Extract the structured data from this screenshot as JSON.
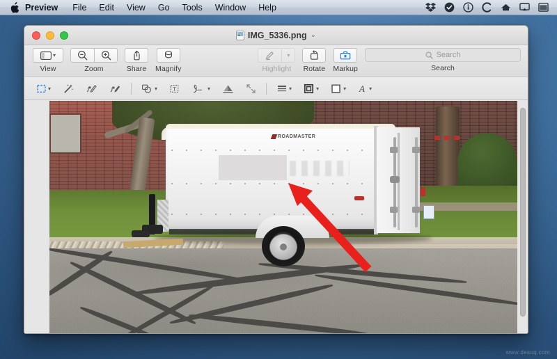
{
  "menubar": {
    "apple_icon": "apple-logo-icon",
    "items": [
      {
        "label": "Preview",
        "bold": true
      },
      {
        "label": "File",
        "bold": false
      },
      {
        "label": "Edit",
        "bold": false
      },
      {
        "label": "View",
        "bold": false
      },
      {
        "label": "Go",
        "bold": false
      },
      {
        "label": "Tools",
        "bold": false
      },
      {
        "label": "Window",
        "bold": false
      },
      {
        "label": "Help",
        "bold": false
      }
    ],
    "status_icons": [
      "dropbox-icon",
      "checkmark-circle-icon",
      "info-circle-icon",
      "chrome-c-icon",
      "home-icon",
      "airplay-icon",
      "calendar-icon"
    ]
  },
  "window": {
    "title": "IMG_5336.png",
    "title_chevron": "⌄",
    "doc_icon": "image-document-icon",
    "traffic_lights": [
      "close-button",
      "minimize-button",
      "zoom-button"
    ]
  },
  "toolbar": {
    "view_label": "View",
    "zoom_label": "Zoom",
    "share_label": "Share",
    "magnify_label": "Magnify",
    "highlight_label": "Highlight",
    "rotate_label": "Rotate",
    "markup_label": "Markup",
    "search_group_label": "Search",
    "search_placeholder": "Search",
    "zoom_out_icon": "zoom-out-icon",
    "zoom_in_icon": "zoom-in-icon",
    "share_icon": "share-icon",
    "magnify_icon": "loupe-icon",
    "highlight_icon": "highlighter-pen-icon",
    "rotate_icon": "rotate-left-icon",
    "markup_icon": "markup-toolbox-icon",
    "search_icon": "search-icon",
    "highlight_disabled": true,
    "markup_active": true
  },
  "markup_bar": {
    "tools": [
      {
        "name": "rectangular-selection-tool",
        "active": true,
        "has_chevron": true
      },
      {
        "name": "instant-alpha-tool",
        "active": false,
        "has_chevron": false
      },
      {
        "name": "sketch-tool",
        "active": false,
        "has_chevron": false
      },
      {
        "name": "draw-tool",
        "active": false,
        "has_chevron": false
      },
      {
        "name": "shapes-tool",
        "active": false,
        "has_chevron": true
      },
      {
        "name": "text-tool",
        "active": false,
        "has_chevron": false
      },
      {
        "name": "signature-tool",
        "active": false,
        "has_chevron": true
      },
      {
        "name": "adjust-color-tool",
        "active": false,
        "has_chevron": false
      },
      {
        "name": "adjust-size-tool",
        "active": false,
        "has_chevron": false
      },
      {
        "name": "shape-style-tool",
        "active": false,
        "has_chevron": true
      },
      {
        "name": "border-color-tool",
        "active": false,
        "has_chevron": true
      },
      {
        "name": "fill-color-tool",
        "active": false,
        "has_chevron": true
      },
      {
        "name": "text-style-tool",
        "active": false,
        "has_chevron": true
      }
    ]
  },
  "photo": {
    "description": "white enclosed cargo trailer parked in a lot in front of a red brick building",
    "trailer_brand": "ROADMASTER",
    "redaction_block": "white-rectangle-redaction",
    "arrow_annotation": "red-arrow-annotation",
    "arrow_color": "#e8211c"
  },
  "colors": {
    "accent_blue": "#3b7fd4",
    "annotation_red": "#e8211c",
    "window_chrome": "#e9e9e9",
    "desktop": "#2b527c"
  },
  "watermark": {
    "text": "www.desuq.com"
  }
}
